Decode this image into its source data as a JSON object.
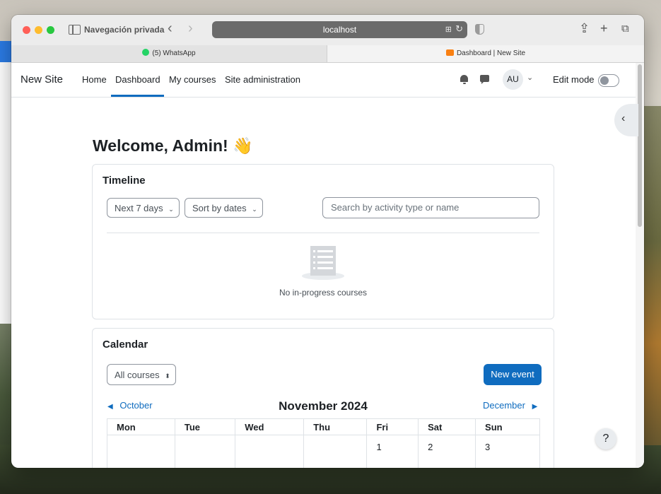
{
  "browser": {
    "private_label": "Navegación privada",
    "url": "localhost",
    "tabs": [
      {
        "label": "(5) WhatsApp",
        "icon": "whatsapp-icon"
      },
      {
        "label": "Dashboard | New Site",
        "icon": "moodle-icon"
      }
    ]
  },
  "navbar": {
    "site_name": "New Site",
    "links": [
      "Home",
      "Dashboard",
      "My courses",
      "Site administration"
    ],
    "active_link": "Dashboard",
    "avatar_initials": "AU",
    "edit_mode_label": "Edit mode",
    "edit_mode_on": false
  },
  "page": {
    "welcome": "Welcome, Admin!",
    "wave_emoji": "👋"
  },
  "timeline": {
    "title": "Timeline",
    "range_select": "Next 7 days",
    "sort_select": "Sort by dates",
    "search_placeholder": "Search by activity type or name",
    "empty_text": "No in-progress courses"
  },
  "calendar": {
    "title": "Calendar",
    "course_filter": "All courses",
    "new_event_label": "New event",
    "prev_month": "October",
    "month_title": "November 2024",
    "next_month": "December",
    "weekdays": [
      "Mon",
      "Tue",
      "Wed",
      "Thu",
      "Fri",
      "Sat",
      "Sun"
    ],
    "first_week": [
      "",
      "",
      "",
      "",
      "1",
      "2",
      "3"
    ]
  },
  "help_label": "?",
  "colors": {
    "primary": "#0f6cbf",
    "text": "#1d2125"
  }
}
